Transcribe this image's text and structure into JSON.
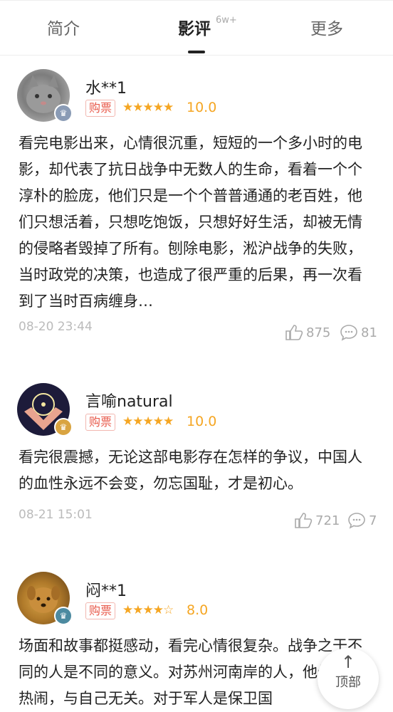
{
  "tabs": {
    "intro": "简介",
    "reviews": "影评",
    "reviews_count": "6w+",
    "more": "更多"
  },
  "reviews": [
    {
      "username": "水**1",
      "ticket_label": "购票",
      "stars": "★★★★★",
      "score": "10.0",
      "text": "看完电影出来，心情很沉重，短短的一个多小时的电影，却代表了抗日战争中无数人的生命，看着一个个淳朴的脸庞，他们只是一个个普普通通的老百姓，他们只想活着，只想吃饱饭，只想好好生活，却被无情的侵略者毁掉了所有。刨除电影，淞沪战争的失败，当时政党的决策，也造成了很严重的后果，再一次看到了当时百病缠身…",
      "date": "08-20 23:44",
      "likes": "875",
      "comments": "81"
    },
    {
      "username": "言喻natural",
      "ticket_label": "购票",
      "stars": "★★★★★",
      "score": "10.0",
      "text": "看完很震撼，无论这部电影存在怎样的争议，中国人的血性永远不会变，勿忘国耻，才是初心。",
      "date": "08-21 15:01",
      "likes": "721",
      "comments": "7"
    },
    {
      "username": "闷**1",
      "ticket_label": "购票",
      "stars": "★★★★☆",
      "score": "8.0",
      "text": "场面和故事都挺感动，看完心情很复杂。战争之于不同的人是不同的意义。对苏州河南岸的人，他们像看热闹，与自己无关。对于军人是保卫国"
    }
  ],
  "float_button": {
    "label": "顶部",
    "arrow": "↑"
  },
  "colors": {
    "accent_orange": "#f5a623",
    "ticket_red": "#e8594a"
  }
}
